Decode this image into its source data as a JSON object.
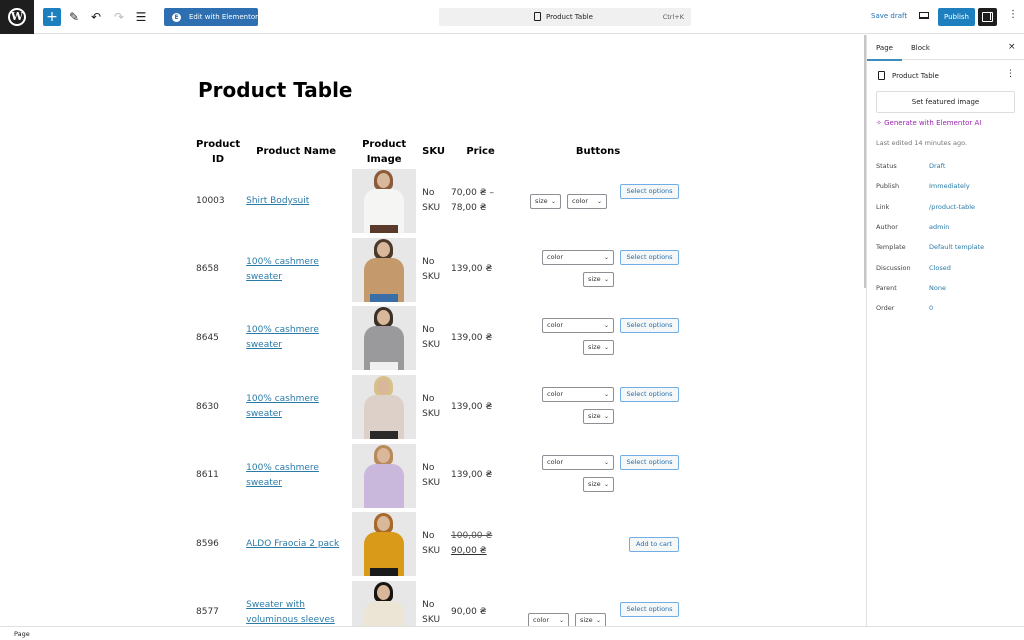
{
  "toolbar": {
    "add_label": "+",
    "edit_elementor_label": "Edit with Elementor",
    "elementor_icon": "E",
    "document_title": "Product Table",
    "shortcut": "Ctrl+K",
    "save_draft_label": "Save draft",
    "publish_label": "Publish",
    "more_label": "⋮",
    "icons": [
      "wordpress-logo",
      "add-block-icon",
      "pen-icon",
      "undo-icon",
      "redo-icon",
      "list-view-icon",
      "preview-icon",
      "settings-icon",
      "more-icon"
    ]
  },
  "page": {
    "title": "Product Table"
  },
  "table": {
    "headers": [
      "Product ID",
      "Product Name",
      "Product Image",
      "SKU",
      "Price",
      "Buttons"
    ],
    "rows": [
      {
        "id": "10003",
        "name": "Shirt Bodysuit",
        "sku": "No SKU",
        "price": "70,00 ₴ – 78,00 ₴",
        "price_old": "",
        "selects": [
          "size",
          "color"
        ],
        "button": "Select options",
        "image": {
          "hair": "#8a5a3a",
          "body": "#f5f5f3",
          "legs": "#5a3a2a"
        }
      },
      {
        "id": "8658",
        "name": "100% cashmere sweater",
        "sku": "No SKU",
        "price": "139,00 ₴",
        "price_old": "",
        "selects": [
          "color",
          "size"
        ],
        "button": "Select options",
        "image": {
          "hair": "#4a3a2a",
          "body": "#c49a6c",
          "legs": "#3a6ea8"
        }
      },
      {
        "id": "8645",
        "name": "100% cashmere sweater",
        "sku": "No SKU",
        "price": "139,00 ₴",
        "price_old": "",
        "selects": [
          "color",
          "size"
        ],
        "button": "Select options",
        "image": {
          "hair": "#3a3026",
          "body": "#9a9a9c",
          "legs": "#f0f0f0"
        }
      },
      {
        "id": "8630",
        "name": "100% cashmere sweater",
        "sku": "No SKU",
        "price": "139,00 ₴",
        "price_old": "",
        "selects": [
          "color",
          "size"
        ],
        "button": "Select options",
        "image": {
          "hair": "#d8c08a",
          "body": "#ddd0c8",
          "legs": "#2a2a2a"
        }
      },
      {
        "id": "8611",
        "name": "100% cashmere sweater",
        "sku": "No SKU",
        "price": "139,00 ₴",
        "price_old": "",
        "selects": [
          "color",
          "size"
        ],
        "button": "Select options",
        "image": {
          "hair": "#b88a5a",
          "body": "#c9b8dc",
          "legs": "#c9b8dc"
        }
      },
      {
        "id": "8596",
        "name": "ALDO Fraocia 2 pack",
        "sku": "No SKU",
        "price": "90,00 ₴",
        "price_old": "100,00 ₴",
        "selects": [],
        "button": "Add to cart",
        "image": {
          "hair": "#a8682a",
          "body": "#d99a1a",
          "legs": "#1a1a1a"
        }
      },
      {
        "id": "8577",
        "name": "Sweater with voluminous sleeves",
        "sku": "No SKU",
        "price": "90,00 ₴",
        "price_old": "",
        "selects": [
          "color",
          "size"
        ],
        "button": "Select options",
        "image": {
          "hair": "#1a1410",
          "body": "#ece4d4",
          "legs": "#ece4d4"
        }
      }
    ]
  },
  "sidebar": {
    "tabs": [
      "Page",
      "Block"
    ],
    "active_tab": "Page",
    "close_label": "×",
    "doc_title": "Product Table",
    "more_label": "⋮",
    "featured_image_label": "Set featured image",
    "generate_ai_label": "✧ Generate with Elementor AI",
    "last_edited": "Last edited 14 minutes ago.",
    "meta": [
      {
        "key": "Status",
        "value": "Draft"
      },
      {
        "key": "Publish",
        "value": "Immediately"
      },
      {
        "key": "Link",
        "value": "/product-table"
      },
      {
        "key": "Author",
        "value": "admin"
      },
      {
        "key": "Template",
        "value": "Default template"
      },
      {
        "key": "Discussion",
        "value": "Closed"
      },
      {
        "key": "Parent",
        "value": "None"
      },
      {
        "key": "Order",
        "value": "0"
      }
    ]
  },
  "statusbar": {
    "breadcrumb": "Page"
  },
  "colors": {
    "accent": "#1e7fbe",
    "link": "#2a7ba8",
    "ai": "#9b27af"
  }
}
